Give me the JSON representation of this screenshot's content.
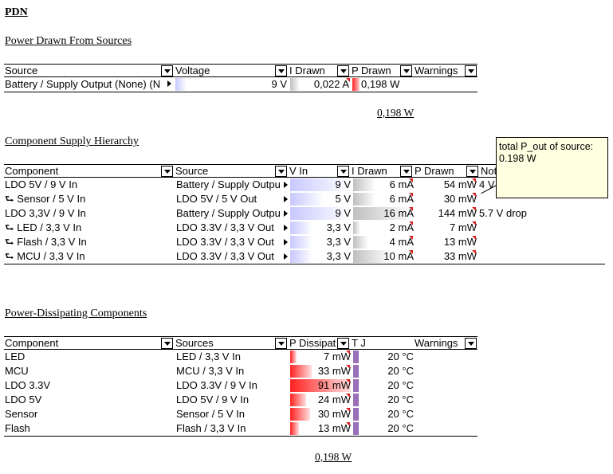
{
  "title": "PDN",
  "sources": {
    "heading": "Power Drawn From Sources",
    "columns": [
      "Source",
      "Voltage",
      "I Drawn",
      "P Drawn",
      "Warnings"
    ],
    "rows": [
      {
        "source": "Battery / Supply Output (None) (N",
        "voltage": "9 V",
        "i": "0,022 A",
        "p": "0,198 W",
        "warn": ""
      }
    ],
    "total": "0,198 W"
  },
  "hierarchy": {
    "heading": "Component Supply Hierarchy",
    "columns": [
      "Component",
      "Source",
      "V In",
      "I Drawn",
      "P Drawn",
      "Not"
    ],
    "rows": [
      {
        "component": "LDO 5V / 9 V In",
        "source": "Battery / Supply Outpu",
        "vin": "9 V",
        "i": "6 mA",
        "p": "54 mW",
        "note": "4 V"
      },
      {
        "component": "⮑ Sensor / 5 V In",
        "source": "LDO 5V / 5 V Out",
        "vin": "5 V",
        "i": "6 mA",
        "p": "30 mW",
        "note": ""
      },
      {
        "component": "LDO 3,3V / 9 V In",
        "source": "Battery / Supply Outpu",
        "vin": "9 V",
        "i": "16 mA",
        "p": "144 mW",
        "note": "5.7 V drop"
      },
      {
        "component": "⮑ LED / 3,3 V In",
        "source": "LDO 3.3V / 3,3 V Out",
        "vin": "3,3 V",
        "i": "2 mA",
        "p": "7 mW",
        "note": ""
      },
      {
        "component": "⮑ Flash / 3,3 V In",
        "source": "LDO 3.3V / 3,3 V Out",
        "vin": "3,3 V",
        "i": "4 mA",
        "p": "13 mW",
        "note": ""
      },
      {
        "component": "⮑ MCU / 3,3 V In",
        "source": "LDO 3.3V / 3,3 V Out",
        "vin": "3,3 V",
        "i": "10 mA",
        "p": "33 mW",
        "note": ""
      }
    ],
    "vin_fill": [
      1.0,
      0.56,
      1.0,
      0.37,
      0.37,
      0.37
    ],
    "i_fill": [
      0.37,
      0.37,
      1.0,
      0.12,
      0.25,
      0.63
    ]
  },
  "dissipating": {
    "heading": "Power-Dissipating Components",
    "columns": [
      "Component",
      "Sources",
      "P Dissipat",
      "T J",
      "Warnings"
    ],
    "rows": [
      {
        "component": "LED",
        "source": "LED / 3,3 V In",
        "p": "7 mW",
        "tj": "20 °C"
      },
      {
        "component": "MCU",
        "source": "MCU / 3,3 V In",
        "p": "33 mW",
        "tj": "20 °C"
      },
      {
        "component": "LDO 3.3V",
        "source": "LDO 3.3V / 9 V In",
        "p": "91 mW",
        "tj": "20 °C"
      },
      {
        "component": "LDO 5V",
        "source": "LDO 5V / 9 V In",
        "p": "24 mW",
        "tj": "20 °C"
      },
      {
        "component": "Sensor",
        "source": "Sensor / 5 V In",
        "p": "30 mW",
        "tj": "20 °C"
      },
      {
        "component": "Flash",
        "source": "Flash / 3,3 V In",
        "p": "13 mW",
        "tj": "20 °C"
      }
    ],
    "p_fill": [
      0.08,
      0.36,
      1.0,
      0.26,
      0.33,
      0.14
    ],
    "total": "0,198 W"
  },
  "tooltip": {
    "line1": "total P_out of source:",
    "line2": "0.198 W"
  },
  "colors": {
    "volt_bar": "#c8c8ff",
    "current_bar": "#c0c0c0",
    "power_bar": "#ff2020",
    "temp_bar": "#9a70b8",
    "comment_marker": "#e02020",
    "tooltip_bg": "#ffffe1"
  }
}
